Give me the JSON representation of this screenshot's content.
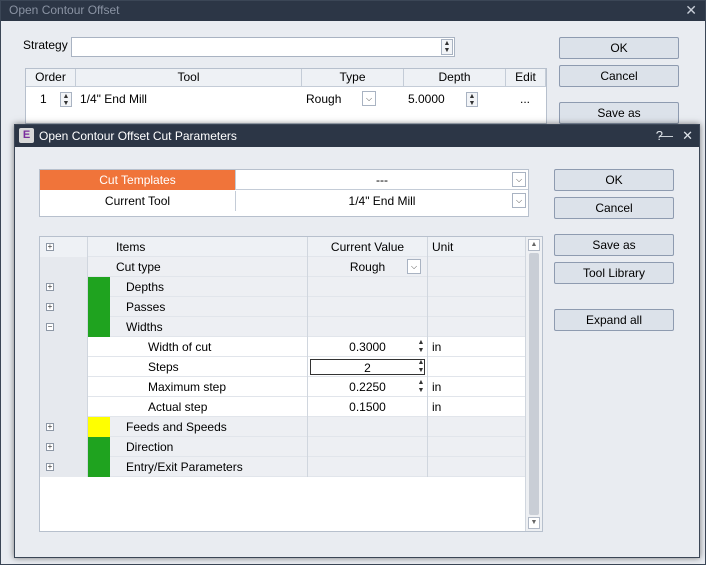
{
  "outer": {
    "title": "Open Contour Offset",
    "strategy_label": "Strategy",
    "strategy_value": "",
    "buttons": {
      "ok": "OK",
      "cancel": "Cancel",
      "save_as": "Save as"
    },
    "table": {
      "headers": [
        "Order",
        "Tool",
        "Type",
        "Depth",
        "Edit"
      ],
      "row": {
        "order": "1",
        "tool": "1/4\" End Mill",
        "type": "Rough",
        "depth": "5.0000",
        "edit": "..."
      }
    }
  },
  "dialog": {
    "title": "Open Contour Offset Cut Parameters",
    "app_icon": "E",
    "templates": {
      "cut_templates_label": "Cut Templates",
      "cut_templates_value": "---",
      "current_tool_label": "Current Tool",
      "current_tool_value": "1/4\" End Mill"
    },
    "buttons": {
      "ok": "OK",
      "cancel": "Cancel",
      "save_as": "Save as",
      "tool_library": "Tool Library",
      "expand_all": "Expand all"
    },
    "grid": {
      "headers": {
        "items": "Items",
        "current_value": "Current Value",
        "unit": "Unit"
      },
      "rows": [
        {
          "name": "Cut type",
          "value": "Rough",
          "unit": "",
          "swatch": "",
          "expander": ""
        },
        {
          "name": "Depths",
          "value": "",
          "unit": "",
          "swatch": "#1fa31f",
          "expander": "+"
        },
        {
          "name": "Passes",
          "value": "",
          "unit": "",
          "swatch": "#1fa31f",
          "expander": "+"
        },
        {
          "name": "Widths",
          "value": "",
          "unit": "",
          "swatch": "#1fa31f",
          "expander": "−"
        },
        {
          "name": "Width of cut",
          "value": "0.3000",
          "unit": "in",
          "swatch": "",
          "expander": ""
        },
        {
          "name": "Steps",
          "value": "2",
          "unit": "",
          "swatch": "",
          "expander": ""
        },
        {
          "name": "Maximum step",
          "value": "0.2250",
          "unit": "in",
          "swatch": "",
          "expander": ""
        },
        {
          "name": "Actual step",
          "value": "0.1500",
          "unit": "in",
          "swatch": "",
          "expander": ""
        },
        {
          "name": "Feeds and Speeds",
          "value": "",
          "unit": "",
          "swatch": "#ffff00",
          "expander": "+"
        },
        {
          "name": "Direction",
          "value": "",
          "unit": "",
          "swatch": "#1fa31f",
          "expander": "+"
        },
        {
          "name": "Entry/Exit Parameters",
          "value": "",
          "unit": "",
          "swatch": "#1fa31f",
          "expander": "+"
        }
      ]
    }
  },
  "colors": {
    "accent_orange": "#f0743a",
    "title_bar": "#2c3646",
    "green": "#1fa31f",
    "yellow": "#ffff00"
  }
}
